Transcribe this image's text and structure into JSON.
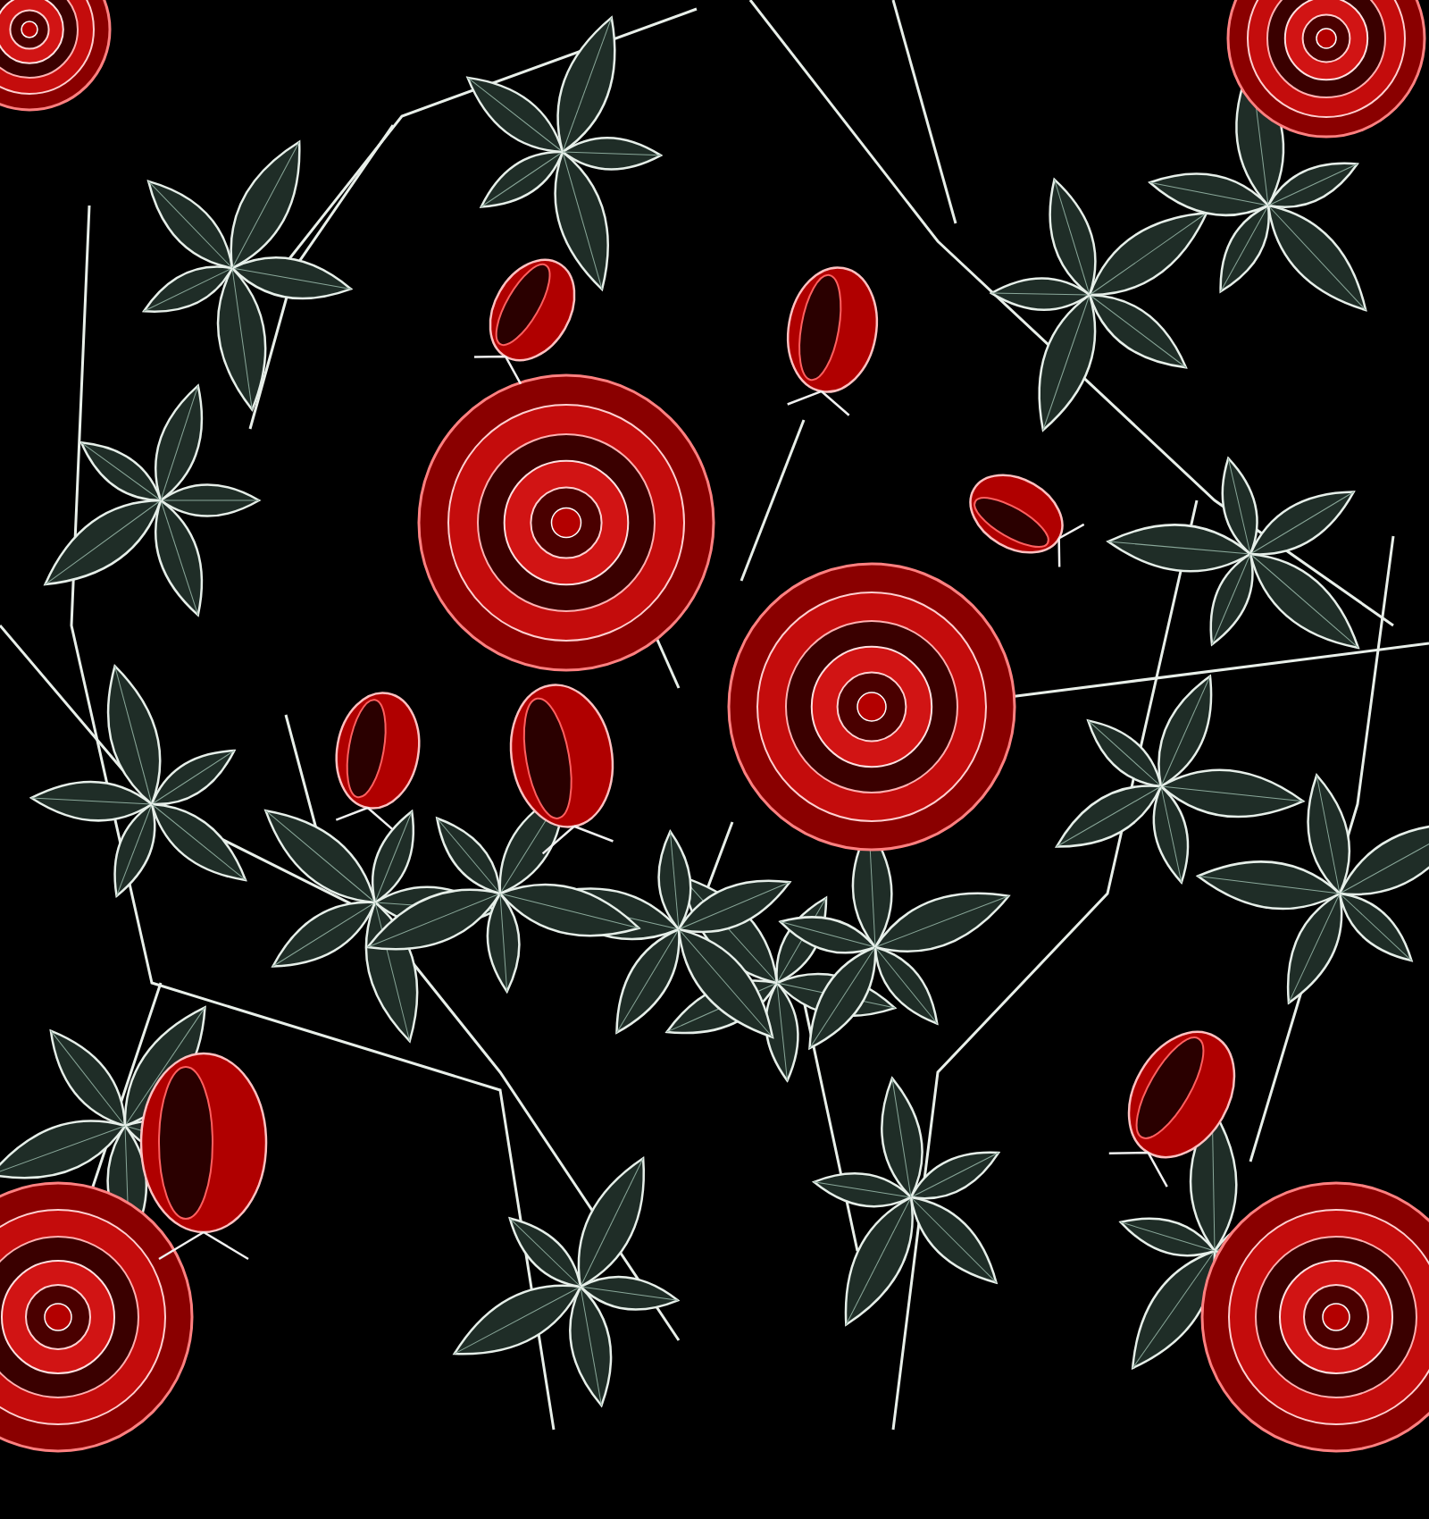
{
  "artwork": {
    "kind": "rose-pattern"
  }
}
